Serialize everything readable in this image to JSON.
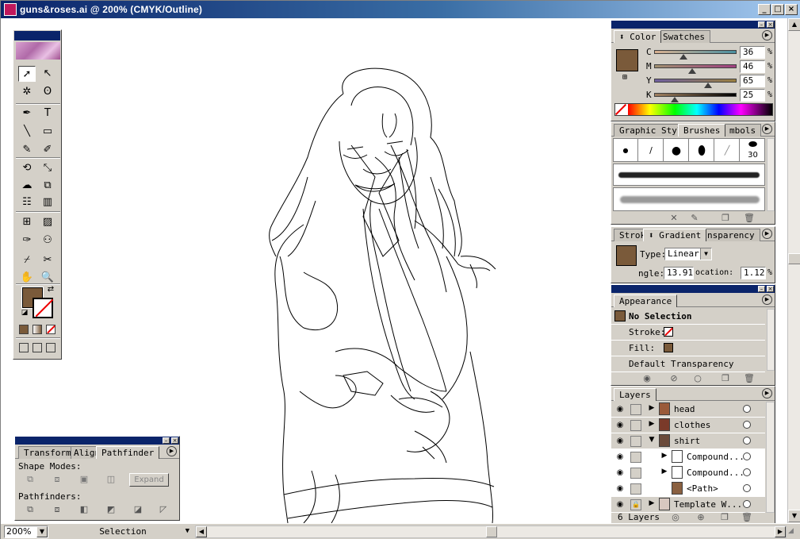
{
  "window": {
    "title": "guns&roses.ai @ 200% (CMYK/Outline)"
  },
  "toolbox": {
    "tools": [
      {
        "name": "selection-tool",
        "glyph": "➚"
      },
      {
        "name": "direct-selection-tool",
        "glyph": "↖"
      },
      {
        "name": "magic-wand-tool",
        "glyph": "✲"
      },
      {
        "name": "lasso-tool",
        "glyph": "ʘ"
      },
      {
        "name": "pen-tool",
        "glyph": "✒"
      },
      {
        "name": "type-tool",
        "glyph": "T"
      },
      {
        "name": "line-tool",
        "glyph": "╲"
      },
      {
        "name": "rectangle-tool",
        "glyph": "▭"
      },
      {
        "name": "paintbrush-tool",
        "glyph": "✎"
      },
      {
        "name": "pencil-tool",
        "glyph": "✐"
      },
      {
        "name": "rotate-tool",
        "glyph": "⟲"
      },
      {
        "name": "scale-tool",
        "glyph": "⤡"
      },
      {
        "name": "warp-tool",
        "glyph": "☁"
      },
      {
        "name": "free-transform-tool",
        "glyph": "⧉"
      },
      {
        "name": "symbol-sprayer-tool",
        "glyph": "☷"
      },
      {
        "name": "graph-tool",
        "glyph": "▥"
      },
      {
        "name": "mesh-tool",
        "glyph": "⊞"
      },
      {
        "name": "gradient-tool",
        "glyph": "▨"
      },
      {
        "name": "eyedropper-tool",
        "glyph": "✑"
      },
      {
        "name": "blend-tool",
        "glyph": "⚇"
      },
      {
        "name": "slice-tool",
        "glyph": "⌿"
      },
      {
        "name": "scissors-tool",
        "glyph": "✂"
      },
      {
        "name": "hand-tool",
        "glyph": "✋"
      },
      {
        "name": "zoom-tool",
        "glyph": "🔍"
      }
    ],
    "fill_color": "#7a5a3a"
  },
  "color_panel": {
    "tabs": [
      "Color",
      "Swatches"
    ],
    "channels": [
      {
        "label": "C",
        "value": "36",
        "pct": 36,
        "grad": "linear-gradient(90deg,#d8b090,#4a90a0)"
      },
      {
        "label": "M",
        "value": "46",
        "pct": 46,
        "grad": "linear-gradient(90deg,#a09070,#a04080)"
      },
      {
        "label": "Y",
        "value": "65",
        "pct": 65,
        "grad": "linear-gradient(90deg,#7060a0,#9a8040)"
      },
      {
        "label": "K",
        "value": "25",
        "pct": 25,
        "grad": "linear-gradient(90deg,#a08060,#000000)"
      }
    ],
    "unit": "%",
    "swatch_color": "#7a5a3a"
  },
  "brush_panel": {
    "tabs": [
      "Graphic Styl",
      "Brushes",
      "mbols"
    ],
    "size_label": "30"
  },
  "gradient_panel": {
    "tabs": [
      "Strok",
      "Gradient",
      "nsparency"
    ],
    "type_label": "Type:",
    "type_value": "Linear",
    "angle_label": "ngle:",
    "angle_value": "13.91",
    "location_label": "ocation:",
    "location_value": "1.12",
    "unit": "%"
  },
  "appearance_panel": {
    "tab": "Appearance",
    "selection_label": "No Selection",
    "stroke_label": "Stroke:",
    "fill_label": "Fill:",
    "transparency_label": "Default Transparency"
  },
  "layers_panel": {
    "tab": "Layers",
    "rows": [
      {
        "name": "head",
        "indent": 0,
        "expander": "▶"
      },
      {
        "name": "clothes",
        "indent": 0,
        "expander": "▶"
      },
      {
        "name": "shirt",
        "indent": 0,
        "expander": "▼"
      },
      {
        "name": "Compound...",
        "indent": 1,
        "expander": "▶"
      },
      {
        "name": "Compound...",
        "indent": 1,
        "expander": "▶"
      },
      {
        "name": "<Path>",
        "indent": 1,
        "expander": ""
      },
      {
        "name": "Template W...",
        "indent": 0,
        "expander": "▶"
      }
    ],
    "count_label": "6 Layers"
  },
  "pathfinder_panel": {
    "tabs": [
      "Transform",
      "Align",
      "Pathfinder"
    ],
    "shape_modes_label": "Shape Modes:",
    "expand_label": "Expand",
    "pathfinders_label": "Pathfinders:"
  },
  "statusbar": {
    "zoom": "200%",
    "mode": "Selection"
  }
}
